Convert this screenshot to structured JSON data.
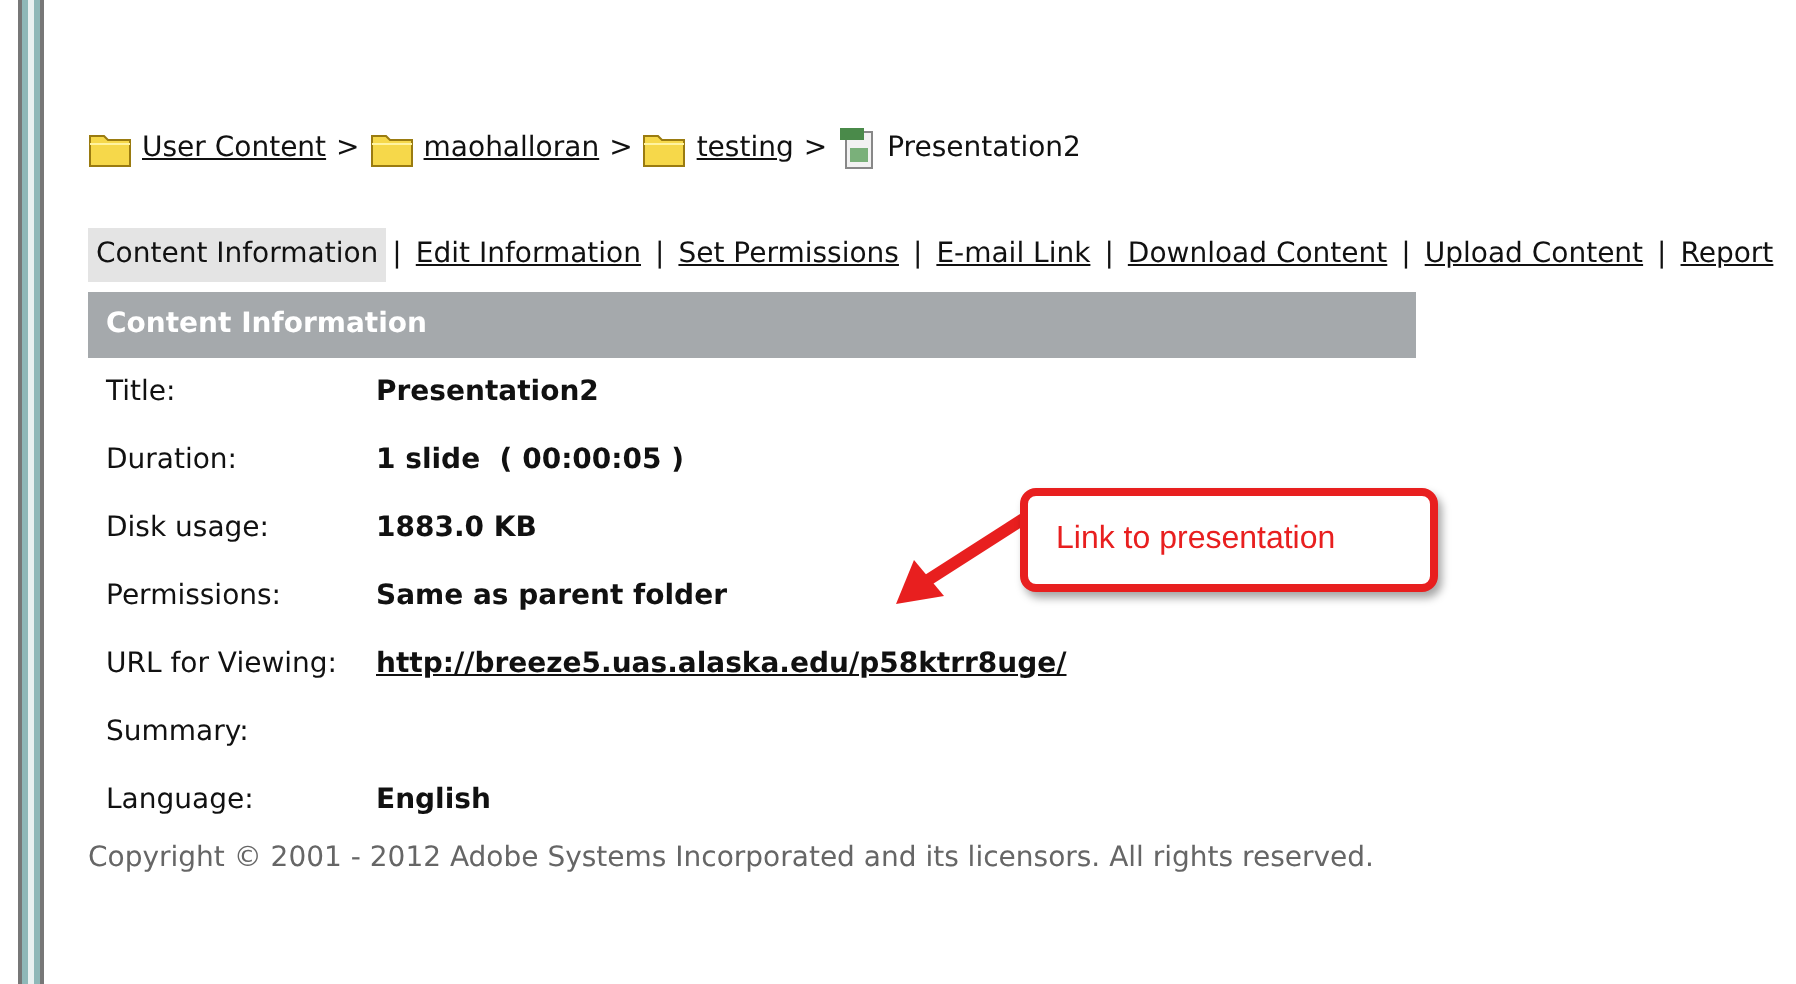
{
  "breadcrumb": [
    {
      "kind": "folder",
      "label": "User Content"
    },
    {
      "kind": "folder",
      "label": "maohalloran"
    },
    {
      "kind": "folder",
      "label": "testing"
    },
    {
      "kind": "presentation",
      "label": "Presentation2"
    }
  ],
  "breadcrumb_separator": ">",
  "tabs": [
    {
      "label": "Content Information",
      "selected": true
    },
    {
      "label": "Edit Information",
      "selected": false
    },
    {
      "label": "Set Permissions",
      "selected": false
    },
    {
      "label": "E-mail Link",
      "selected": false
    },
    {
      "label": "Download Content",
      "selected": false
    },
    {
      "label": "Upload Content",
      "selected": false
    },
    {
      "label": "Report",
      "selected": false
    }
  ],
  "tab_separator": "|",
  "panel": {
    "title": "Content Information",
    "rows": [
      {
        "kind": "text",
        "label": "Title:",
        "value": "Presentation2"
      },
      {
        "kind": "text",
        "label": "Duration:",
        "value": "1 slide  ( 00:00:05 )"
      },
      {
        "kind": "text",
        "label": "Disk usage:",
        "value": "1883.0 KB"
      },
      {
        "kind": "text",
        "label": "Permissions:",
        "value": "Same as parent folder"
      },
      {
        "kind": "link",
        "label": "URL for Viewing:",
        "value": "http://breeze5.uas.alaska.edu/p58ktrr8uge/"
      },
      {
        "label": "Summary:"
      },
      {
        "kind": "text",
        "label": "Language:",
        "value": "English"
      }
    ]
  },
  "callout": {
    "text": "Link to presentation"
  },
  "footer": "Copyright © 2001 - 2012 Adobe Systems Incorporated and its licensors. All rights reserved."
}
